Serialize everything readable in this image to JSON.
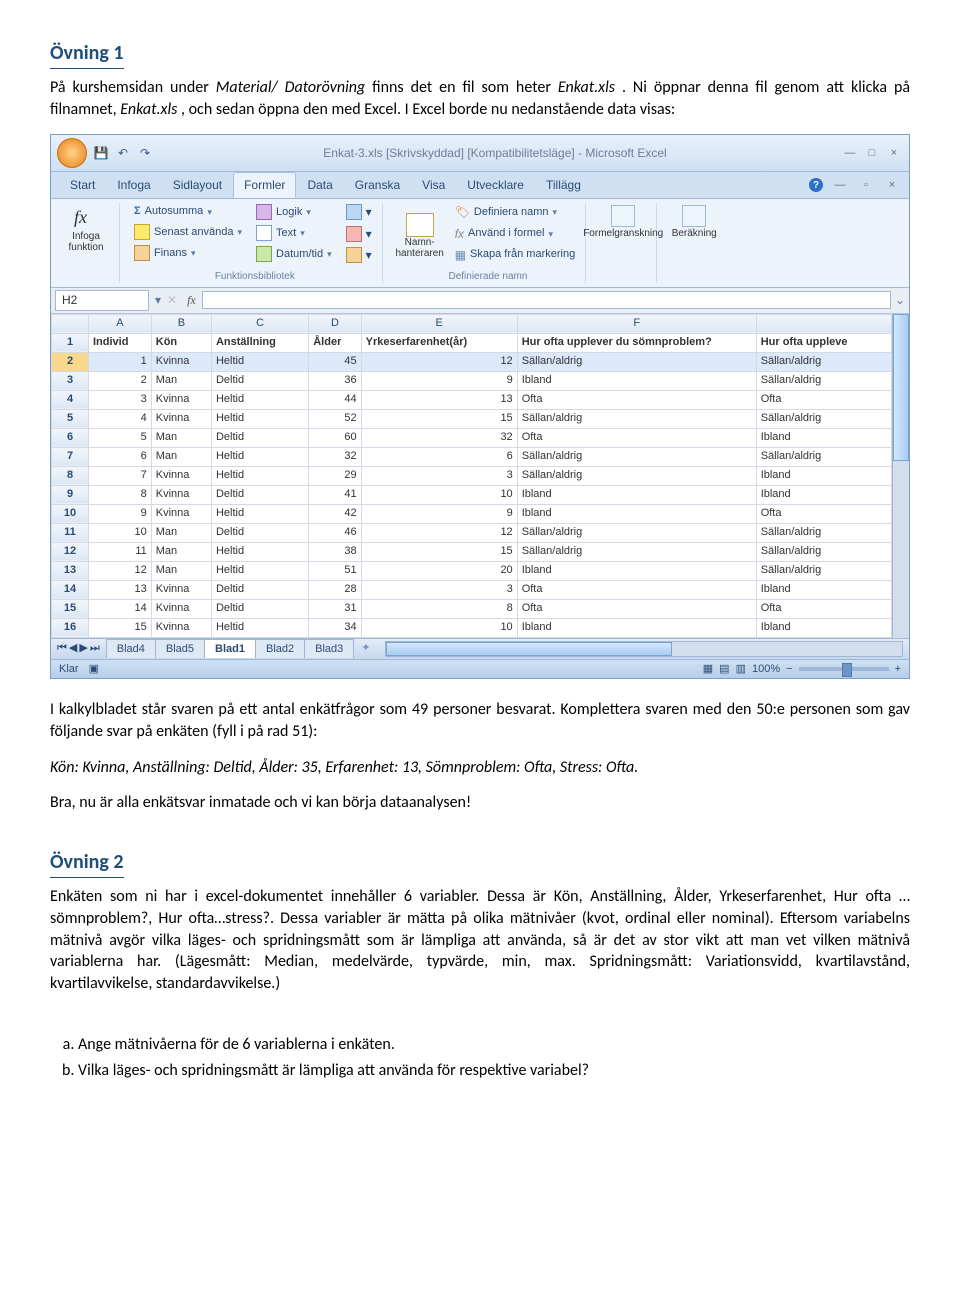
{
  "exercise1": {
    "title": "Övning 1",
    "p1_a": "På kurshemsidan under ",
    "p1_b": "Material/ Datorövning",
    "p1_c": " finns det en fil som heter ",
    "p1_d": "Enkat.xls",
    "p1_e": ". Ni öppnar denna fil genom att klicka på filnamnet, ",
    "p1_f": "Enkat.xls",
    "p1_g": ", och sedan öppna den med Excel. I Excel borde nu nedanstående data visas:"
  },
  "excel": {
    "title": "Enkat-3.xls  [Skrivskyddad]  [Kompatibilitetsläge] - Microsoft Excel",
    "tabs": [
      "Start",
      "Infoga",
      "Sidlayout",
      "Formler",
      "Data",
      "Granska",
      "Visa",
      "Utvecklare",
      "Tillägg"
    ],
    "active_tab": "Formler",
    "groups": {
      "insertfn": "Infoga funktion",
      "lib": "Funktionsbibliotek",
      "names": "Definierade namn",
      "audit": "Formelgranskning",
      "calc": "Beräkning"
    },
    "btns": {
      "autosum": "Autosumma",
      "recent": "Senast använda",
      "finance": "Finans",
      "logic": "Logik",
      "text": "Text",
      "date": "Datum/tid",
      "namemgr_a": "Namn-",
      "namemgr_b": "hanteraren",
      "defname": "Definiera namn",
      "useinfm": "Använd i formel",
      "createsel": "Skapa från markering"
    },
    "namebox": "H2",
    "fx": "",
    "col_letters": [
      "A",
      "B",
      "C",
      "D",
      "E",
      "F",
      ""
    ],
    "headers": [
      "Individ",
      "Kön",
      "Anställning",
      "Ålder",
      "Yrkeserfarenhet(år)",
      "Hur ofta upplever du sömnproblem?",
      "Hur ofta uppleve"
    ],
    "rows": [
      {
        "n": "2",
        "d": [
          "1",
          "Kvinna",
          "Heltid",
          "45",
          "12",
          "Sällan/aldrig",
          "Sällan/aldrig"
        ]
      },
      {
        "n": "3",
        "d": [
          "2",
          "Man",
          "Deltid",
          "36",
          "9",
          "Ibland",
          "Sällan/aldrig"
        ]
      },
      {
        "n": "4",
        "d": [
          "3",
          "Kvinna",
          "Heltid",
          "44",
          "13",
          "Ofta",
          "Ofta"
        ]
      },
      {
        "n": "5",
        "d": [
          "4",
          "Kvinna",
          "Heltid",
          "52",
          "15",
          "Sällan/aldrig",
          "Sällan/aldrig"
        ]
      },
      {
        "n": "6",
        "d": [
          "5",
          "Man",
          "Deltid",
          "60",
          "32",
          "Ofta",
          "Ibland"
        ]
      },
      {
        "n": "7",
        "d": [
          "6",
          "Man",
          "Heltid",
          "32",
          "6",
          "Sällan/aldrig",
          "Sällan/aldrig"
        ]
      },
      {
        "n": "8",
        "d": [
          "7",
          "Kvinna",
          "Heltid",
          "29",
          "3",
          "Sällan/aldrig",
          "Ibland"
        ]
      },
      {
        "n": "9",
        "d": [
          "8",
          "Kvinna",
          "Deltid",
          "41",
          "10",
          "Ibland",
          "Ibland"
        ]
      },
      {
        "n": "10",
        "d": [
          "9",
          "Kvinna",
          "Heltid",
          "42",
          "9",
          "Ibland",
          "Ofta"
        ]
      },
      {
        "n": "11",
        "d": [
          "10",
          "Man",
          "Deltid",
          "46",
          "12",
          "Sällan/aldrig",
          "Sällan/aldrig"
        ]
      },
      {
        "n": "12",
        "d": [
          "11",
          "Man",
          "Heltid",
          "38",
          "15",
          "Sällan/aldrig",
          "Sällan/aldrig"
        ]
      },
      {
        "n": "13",
        "d": [
          "12",
          "Man",
          "Heltid",
          "51",
          "20",
          "Ibland",
          "Sällan/aldrig"
        ]
      },
      {
        "n": "14",
        "d": [
          "13",
          "Kvinna",
          "Deltid",
          "28",
          "3",
          "Ofta",
          "Ibland"
        ]
      },
      {
        "n": "15",
        "d": [
          "14",
          "Kvinna",
          "Deltid",
          "31",
          "8",
          "Ofta",
          "Ofta"
        ]
      },
      {
        "n": "16",
        "d": [
          "15",
          "Kvinna",
          "Heltid",
          "34",
          "10",
          "Ibland",
          "Ibland"
        ]
      }
    ],
    "sheet_tabs": [
      "Blad4",
      "Blad5",
      "Blad1",
      "Blad2",
      "Blad3"
    ],
    "active_sheet": "Blad1",
    "status": "Klar",
    "zoom": "100%"
  },
  "after_excel": {
    "p1": "I kalkylbladet står svaren på ett antal enkätfrågor som 49 personer besvarat. Komplettera svaren med den 50:e personen som gav följande svar på enkäten (fyll i på rad 51):",
    "p2": "Kön: Kvinna, Anställning: Deltid, Ålder: 35, Erfarenhet: 13, Sömnproblem: Ofta, Stress: Ofta.",
    "p3": "Bra, nu är alla enkätsvar inmatade och vi kan börja dataanalysen!"
  },
  "exercise2": {
    "title": "Övning 2",
    "p1": "Enkäten som ni har i excel-dokumentet innehåller 6 variabler. Dessa är Kön, Anställning, Ålder, Yrkeserfarenhet, Hur ofta … sömnproblem?, Hur ofta…stress?. Dessa variabler är mätta på olika mätnivåer (kvot, ordinal eller nominal). Eftersom variabelns mätnivå avgör vilka läges- och spridningsmått som är lämpliga att använda, så är det av stor vikt att man vet vilken mätnivå variablerna har. (Lägesmått: Median, medelvärde, typvärde, min, max. Spridningsmått: Variationsvidd, kvartilavstånd, kvartilavvikelse, standardavvikelse.)",
    "q_a": "Ange mätnivåerna för de 6 variablerna i enkäten.",
    "q_b": "Vilka läges- och spridningsmått är lämpliga att använda för respektive variabel?"
  }
}
